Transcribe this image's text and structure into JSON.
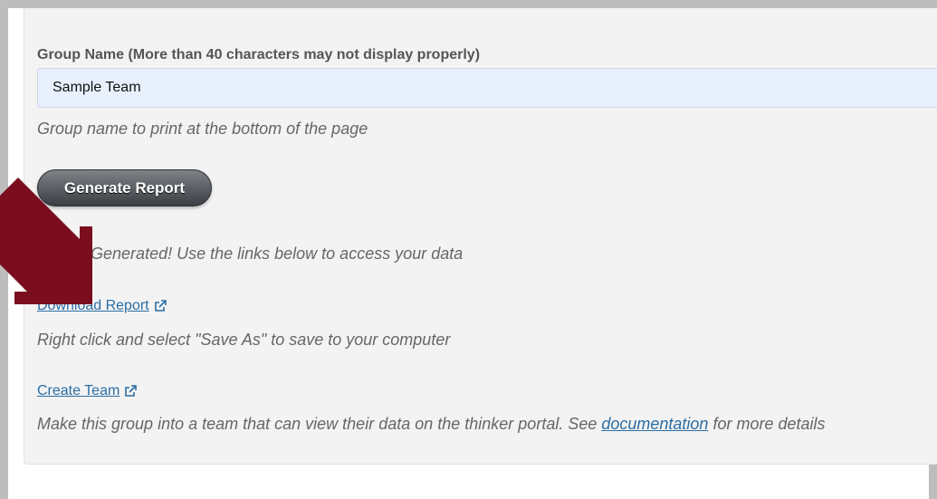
{
  "form": {
    "group_name_label": "Group Name (More than 40 characters may not display properly)",
    "group_name_value": "Sample Team",
    "group_name_help": "Group name to print at the bottom of the page",
    "generate_button": "Generate Report",
    "status_text": "Report Generated! Use the links below to access your data"
  },
  "links": {
    "download_report": "Download Report",
    "download_help": "Right click and select \"Save As\" to save to your computer",
    "create_team": "Create Team",
    "create_team_help_prefix": "Make this group into a team that can view their data on the thinker portal. See ",
    "documentation": "documentation",
    "create_team_help_suffix": " for more details"
  },
  "colors": {
    "arrow": "#7a0e1f",
    "link": "#2b6da3"
  },
  "icons": {
    "external": "external-link-icon",
    "arrow": "down-left-arrow-icon"
  }
}
